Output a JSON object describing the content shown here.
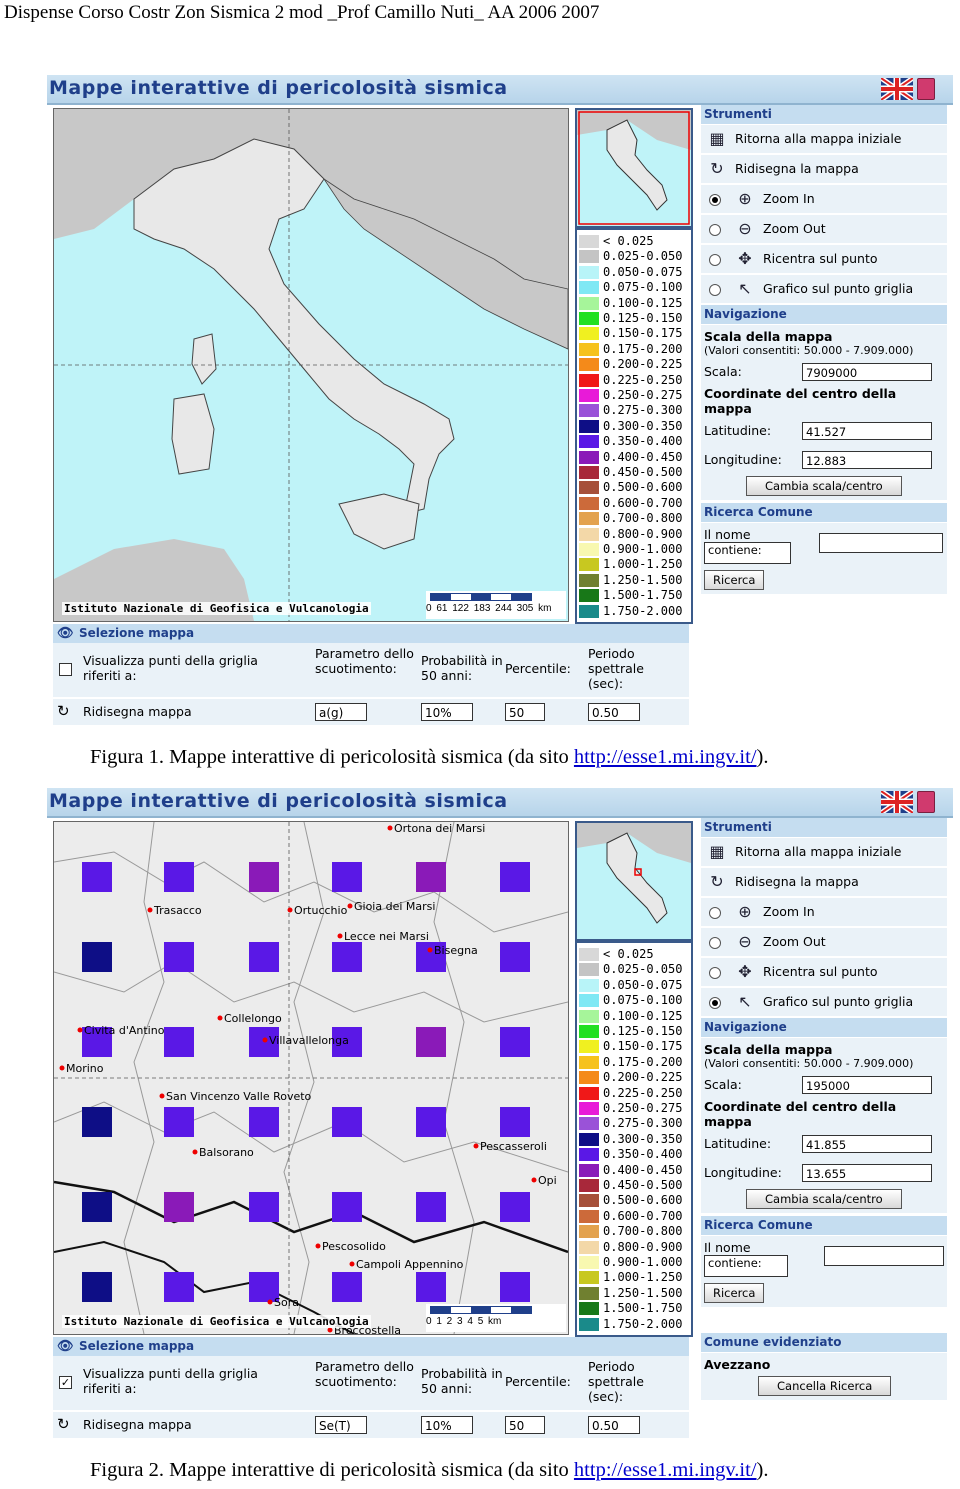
{
  "header": "Dispense Corso Costr Zon Sismica 2 mod _Prof Camillo Nuti_ AA 2006 2007",
  "app_title": "Mappe interattive di pericolosità sismica",
  "institute": "Istituto Nazionale di Geofisica e Vulcanologia",
  "legend": [
    {
      "label": "< 0.025",
      "color": "#d8d8d8"
    },
    {
      "label": "0.025-0.050",
      "color": "#c4c4c4"
    },
    {
      "label": "0.050-0.075",
      "color": "#b8f4f8"
    },
    {
      "label": "0.075-0.100",
      "color": "#7fe8f4"
    },
    {
      "label": "0.100-0.125",
      "color": "#a6f59a"
    },
    {
      "label": "0.125-0.150",
      "color": "#22e022"
    },
    {
      "label": "0.150-0.175",
      "color": "#f0f020"
    },
    {
      "label": "0.175-0.200",
      "color": "#f6c21c"
    },
    {
      "label": "0.200-0.225",
      "color": "#f48a1a"
    },
    {
      "label": "0.225-0.250",
      "color": "#f01818"
    },
    {
      "label": "0.250-0.275",
      "color": "#e81ad8"
    },
    {
      "label": "0.275-0.300",
      "color": "#9a52d8"
    },
    {
      "label": "0.300-0.350",
      "color": "#0e0e86"
    },
    {
      "label": "0.350-0.400",
      "color": "#5a18e6"
    },
    {
      "label": "0.400-0.450",
      "color": "#8a1ab8"
    },
    {
      "label": "0.450-0.500",
      "color": "#a8283a"
    },
    {
      "label": "0.500-0.600",
      "color": "#a6503a"
    },
    {
      "label": "0.600-0.700",
      "color": "#cc6a3a"
    },
    {
      "label": "0.700-0.800",
      "color": "#e3a24e"
    },
    {
      "label": "0.800-0.900",
      "color": "#f3d8a8"
    },
    {
      "label": "0.900-1.000",
      "color": "#f8f8b0"
    },
    {
      "label": "1.000-1.250",
      "color": "#c8c820"
    },
    {
      "label": "1.250-1.500",
      "color": "#708030"
    },
    {
      "label": "1.500-1.750",
      "color": "#187818"
    },
    {
      "label": "1.750-2.000",
      "color": "#1a8a8a"
    }
  ],
  "tools": {
    "header": "Strumenti",
    "items": [
      "Ritorna alla mappa iniziale",
      "Ridisegna la mappa",
      "Zoom In",
      "Zoom Out",
      "Ricentra sul punto",
      "Grafico sul punto griglia"
    ]
  },
  "nav": {
    "header": "Navigazione",
    "scale_title": "Scala della mappa",
    "scale_note": "(Valori consentiti: 50.000 - 7.909.000)",
    "scale_label": "Scala:",
    "center_title": "Coordinate del centro della mappa",
    "lat_label": "Latitudine:",
    "lon_label": "Longitudine:",
    "apply_button": "Cambia scala/centro"
  },
  "search": {
    "header": "Ricerca Comune",
    "name_label": "Il nome",
    "mode": "contiene:",
    "button": "Ricerca"
  },
  "highlight": {
    "header": "Comune evidenziato",
    "town": "Avezzano",
    "button": "Cancella Ricerca"
  },
  "selection": {
    "header": "Selezione mappa",
    "grid_label": "Visualizza punti della griglia riferiti a:",
    "param_label": "Parametro dello scuotimento:",
    "prob_label": "Probabilità in 50 anni:",
    "perc_label": "Percentile:",
    "period_label": "Periodo spettrale (sec):",
    "redraw": "Ridisegna mappa"
  },
  "fig1": {
    "scale": "7909000",
    "lat": "41.527",
    "lon": "12.883",
    "param": "a(g)",
    "prob": "10%",
    "perc": "50",
    "period": "0.50",
    "scalebar": "0 61 122 183 244 305 km",
    "checkbox": "",
    "caption_text": "Figura 1. Mappe interattive di pericolosità sismica (da sito ",
    "caption_link": "http://esse1.mi.ingv.it/",
    "caption_end": ")."
  },
  "fig2": {
    "scale": "195000",
    "lat": "41.855",
    "lon": "13.655",
    "param": "Se(T)",
    "prob": "10%",
    "perc": "50",
    "period": "0.50",
    "scalebar": "0 1 2 3 4 5 km",
    "checkbox": "✓",
    "towns": [
      "Ortona dei Marsi",
      "Trasacco",
      "Ortucchio",
      "Gioia dei Marsi",
      "Lecce nei Marsi",
      "Bisegna",
      "Civita d'Antino",
      "Collelongo",
      "Villavallelonga",
      "Morino",
      "San Vincenzo Valle Roveto",
      "Balsorano",
      "Pescasseroli",
      "Opi",
      "Pescosolido",
      "Campoli Appennino",
      "Sora",
      "Broccostella"
    ],
    "caption_text": "Figura 2. Mappe interattive di pericolosità sismica (da sito ",
    "caption_link": "http://esse1.mi.ingv.it/",
    "caption_end": ")."
  }
}
